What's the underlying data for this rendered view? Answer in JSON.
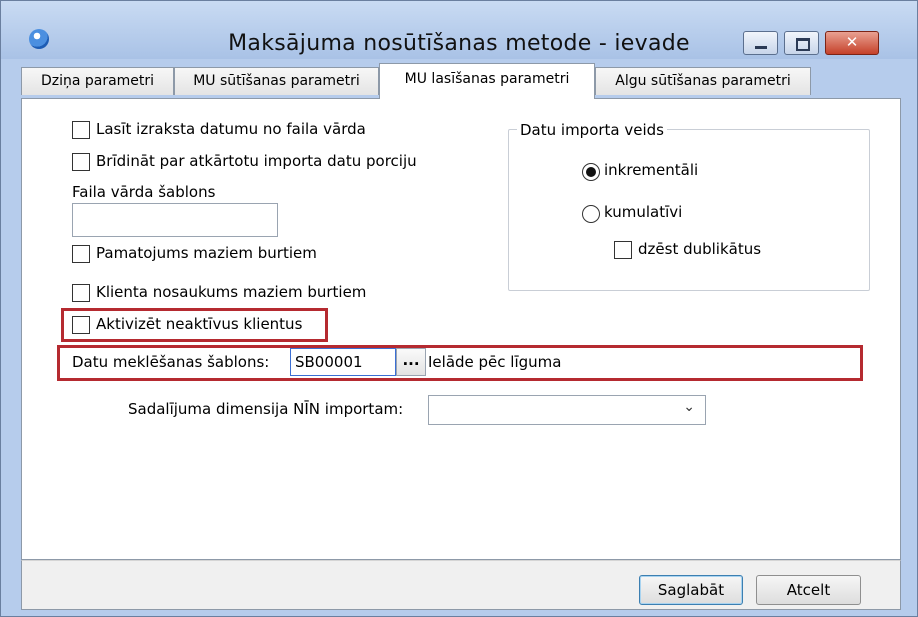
{
  "window": {
    "title": "Maksājuma nosūtīšanas metode - ievade"
  },
  "tabs": [
    {
      "label": "Dziņa parametri"
    },
    {
      "label": "MU sūtīšanas parametri"
    },
    {
      "label": "MU lasīšanas parametri"
    },
    {
      "label": "Algu sūtīšanas parametri"
    }
  ],
  "active_tab": "MU lasīšanas parametri",
  "options": {
    "read_date_from_filename": {
      "label": "Lasīt izraksta datumu no faila vārda",
      "checked": false
    },
    "warn_repeated_import": {
      "label": "Brīdināt par atkārtotu importa datu porciju",
      "checked": false
    },
    "filename_template_label": "Faila vārda šablons",
    "filename_template_value": "",
    "reason_lowercase": {
      "label": "Pamatojums maziem burtiem",
      "checked": false
    },
    "client_name_lowercase": {
      "label": "Klienta nosaukums maziem burtiem",
      "checked": false
    },
    "activate_inactive_clients": {
      "label": "Aktivizēt neaktīvus klientus",
      "checked": false
    }
  },
  "import_type": {
    "title": "Datu importa veids",
    "incremental": {
      "label": "inkrementāli",
      "selected": true
    },
    "cumulative": {
      "label": "kumulatīvi",
      "selected": false
    },
    "delete_duplicates": {
      "label": "dzēst dublikātus",
      "checked": false
    }
  },
  "search_template": {
    "label": "Datu meklēšanas šablons:",
    "value": "SB00001",
    "button_label": "...",
    "description": "Ielāde pēc līguma"
  },
  "dimension": {
    "label": "Sadalījuma dimensija NĪN importam:",
    "value": ""
  },
  "buttons": {
    "save": "Saglabāt",
    "cancel": "Atcelt"
  },
  "icons": {
    "app": "app-globe-icon",
    "minimize": "minimize-icon",
    "maximize": "maximize-icon",
    "close": "close-icon",
    "dropdown": "chevron-down-icon"
  },
  "colors": {
    "highlight_border": "#b52a30",
    "title_bar": "#b6ccec"
  }
}
